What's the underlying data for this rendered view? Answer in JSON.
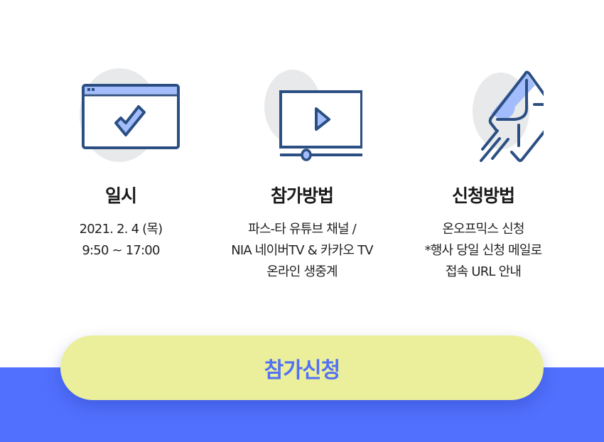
{
  "sections": [
    {
      "title": "일시",
      "lines": [
        "2021. 2. 4 (목)",
        "9:50 ~ 17:00"
      ]
    },
    {
      "title": "참가방법",
      "lines": [
        "파스-타 유튜브 채널 /",
        "NIA 네이버TV & 카카오 TV",
        "온라인 생중계"
      ]
    },
    {
      "title": "신청방법",
      "lines": [
        "온오프믹스 신청",
        "*행사 당일 신청 메일로",
        "접속 URL 안내"
      ]
    }
  ],
  "cta": {
    "label": "참가신청"
  },
  "colors": {
    "accent": "#5170fd",
    "button": "#ebef9b",
    "icon_stroke": "#2c4f83",
    "icon_fill": "#a3bdfc"
  }
}
